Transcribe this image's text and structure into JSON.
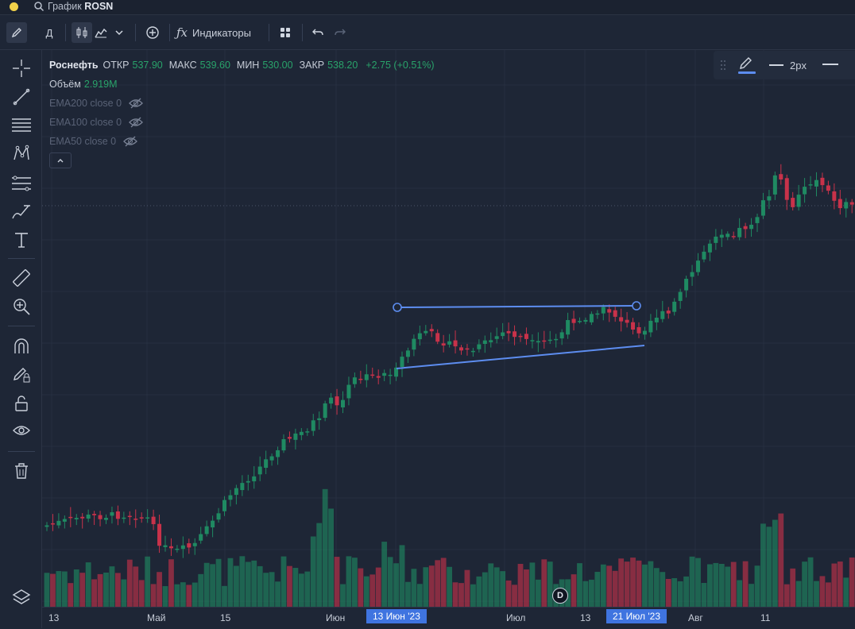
{
  "window": {
    "title_prefix": "График",
    "title_symbol": "ROSN"
  },
  "toolbar": {
    "interval_label": "Д",
    "indicators_label": "Индикаторы"
  },
  "legend": {
    "symbol": "Роснефть",
    "open_label": "ОТКР",
    "open_value": "537.90",
    "high_label": "МАКС",
    "high_value": "539.60",
    "low_label": "МИН",
    "low_value": "530.00",
    "close_label": "ЗАКР",
    "close_value": "538.20",
    "change": "+2.75 (+0.51%)",
    "volume_label": "Объём",
    "volume_value": "2.919M",
    "indicators": [
      {
        "label": "EMA200 close 0"
      },
      {
        "label": "EMA100 close 0"
      },
      {
        "label": "EMA50 close 0"
      }
    ]
  },
  "draw_panel": {
    "width_label": "2px"
  },
  "x_axis": {
    "labels": [
      "13",
      "Май",
      "15",
      "Июн",
      "Июл",
      "13",
      "Авг",
      "11"
    ],
    "highlight_start": "13 Июн '23",
    "highlight_end": "21 Июл '23"
  },
  "badge": "D",
  "colors": {
    "up": "#1f8a62",
    "down": "#c8324a",
    "line": "#5d8df0",
    "accent": "#3f74e0"
  }
}
